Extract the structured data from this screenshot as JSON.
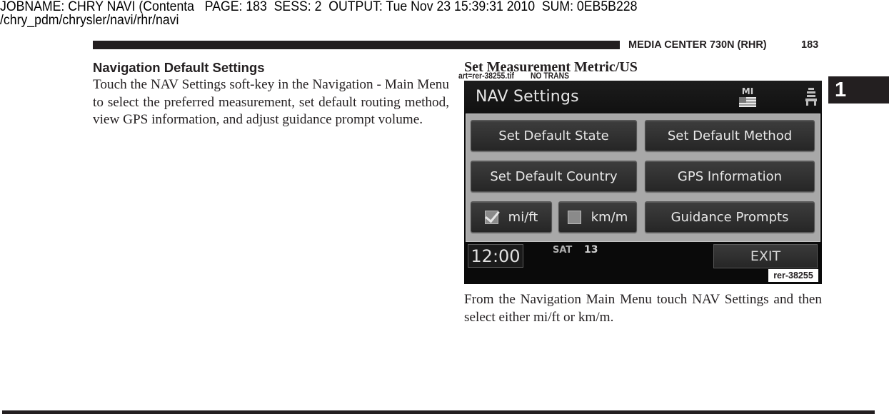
{
  "print_slug": {
    "line1": "JOBNAME: CHRY NAVI (Contenta   PAGE: 183  SESS: 2  OUTPUT: Tue Nov 23 15:39:31 2010  SUM: 0EB5B228",
    "line2": "/chry_pdm/chrysler/navi/rhr/navi"
  },
  "running_header": {
    "title": "MEDIA CENTER 730N (RHR)",
    "page_number": "183"
  },
  "section_tab": "1",
  "left_column": {
    "heading": "Navigation Default Settings",
    "body": "Touch the NAV Settings soft-key in the Navigation - Main Menu to select the preferred measurement, set default routing method, view GPS information, and adjust guidance prompt volume."
  },
  "right_column": {
    "heading": "Set Measurement Metric/US",
    "art_tag": "art=rer-38255.tif        NO TRANS",
    "caption": "From the Navigation Main Menu touch NAV Settings and then select either mi/ft or km/m."
  },
  "screen": {
    "title": "NAV Settings",
    "state_code": "MI",
    "buttons": {
      "set_default_state": "Set Default State",
      "set_default_method": "Set Default Method",
      "set_default_country": "Set Default Country",
      "gps_information": "GPS Information",
      "guidance_prompts": "Guidance Prompts"
    },
    "units": {
      "mi_ft": {
        "label": "mi/ft",
        "checked": true
      },
      "km_m": {
        "label": "km/m",
        "checked": false
      }
    },
    "clock": "12:00",
    "day": "SAT",
    "date": "13",
    "exit_label": "EXIT",
    "reference_label": "rer-38255"
  }
}
